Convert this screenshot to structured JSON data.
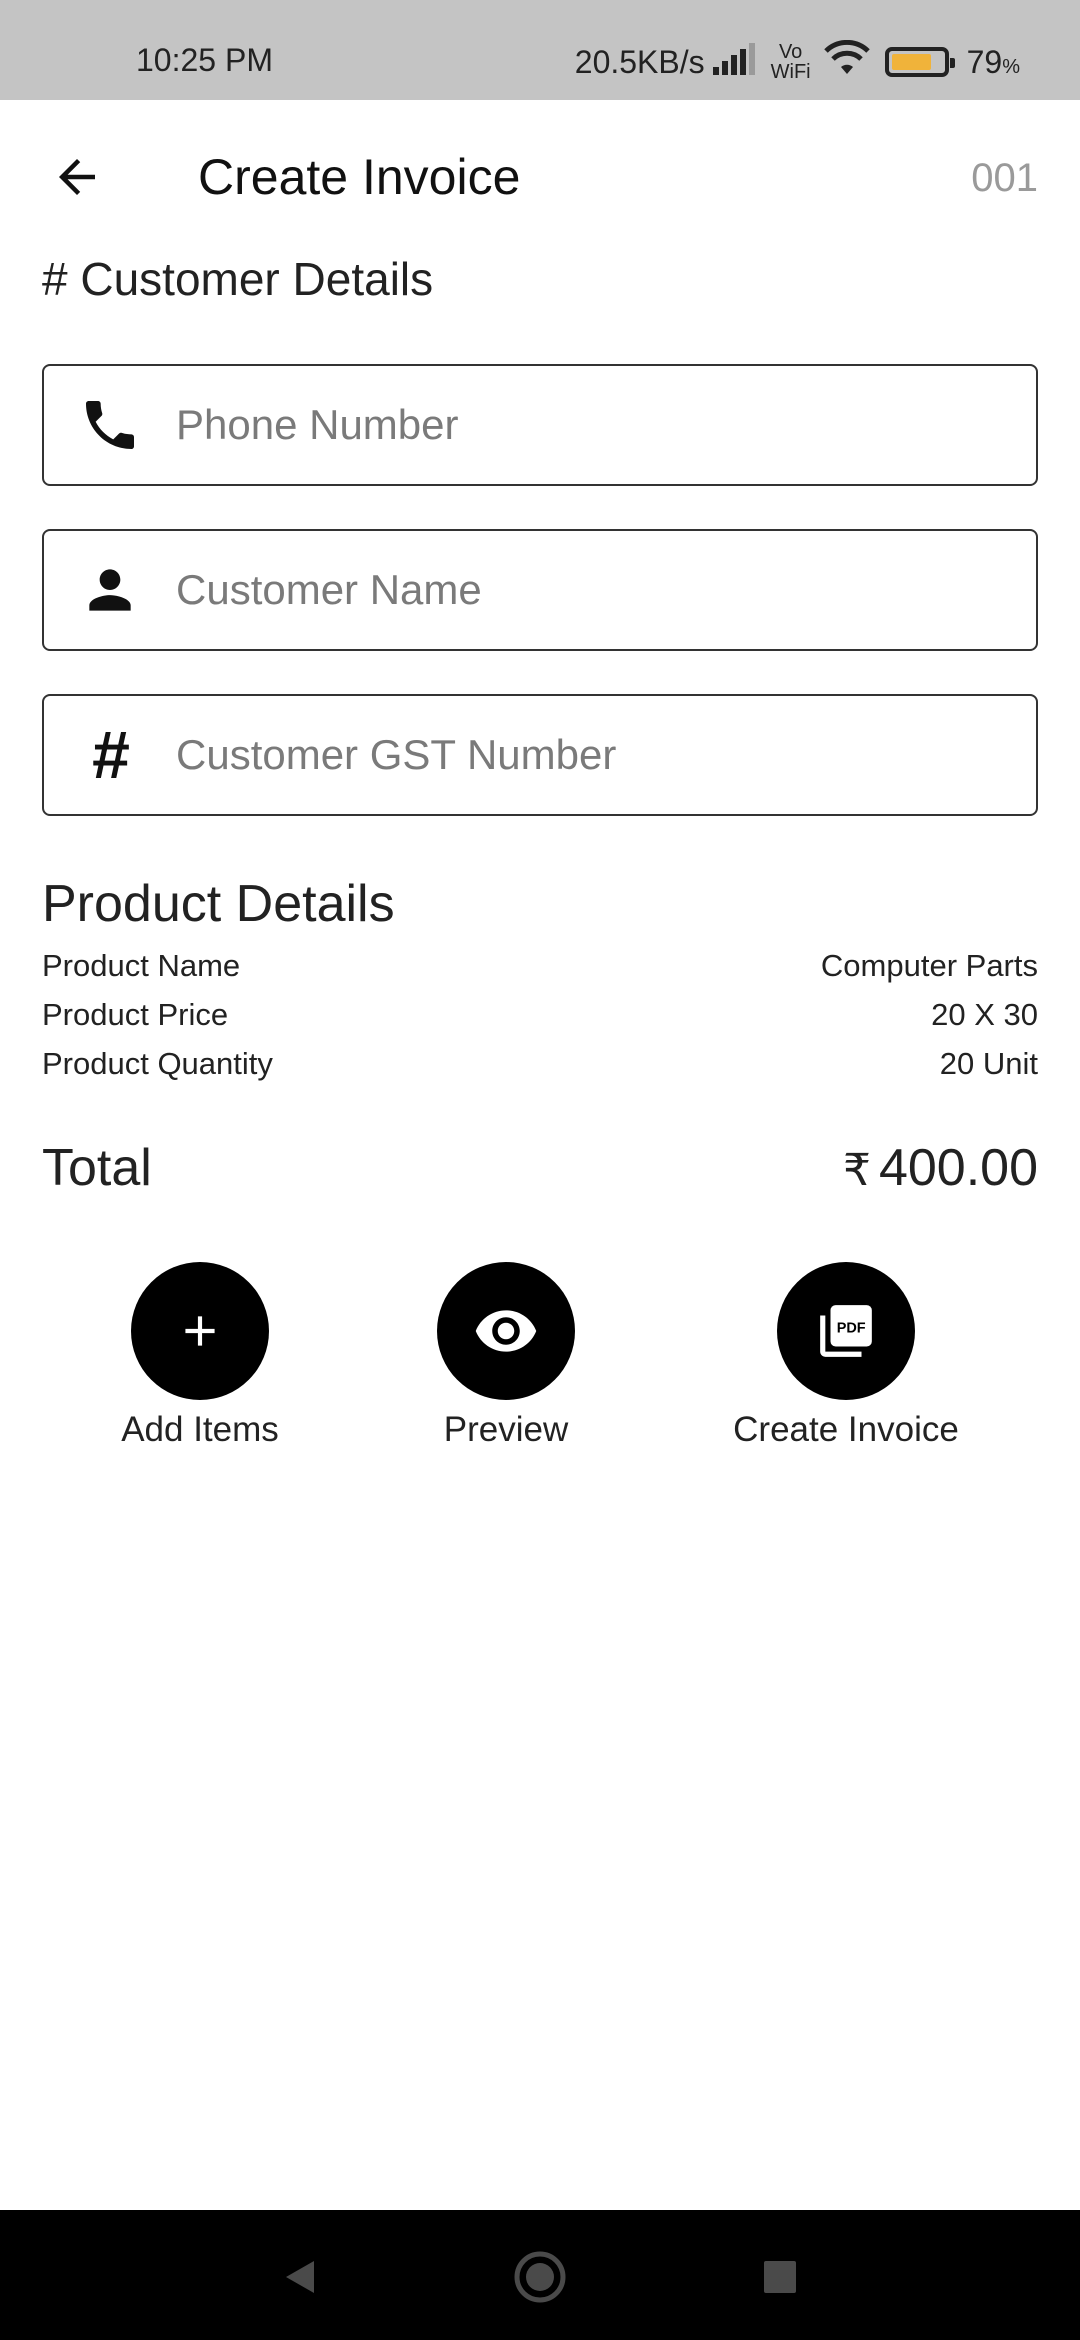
{
  "status_bar": {
    "time": "10:25 PM",
    "network_speed": "20.5KB/s",
    "vowifi_top": "Vo",
    "vowifi_bottom": "WiFi",
    "battery_percent": "79",
    "battery_percent_sign": "%",
    "battery_level": 0.79
  },
  "app_bar": {
    "title": "Create Invoice",
    "invoice_number": "001",
    "back_icon": "arrow-back-icon"
  },
  "customer_section": {
    "title": "# Customer Details",
    "fields": [
      {
        "icon": "phone-icon",
        "placeholder": "Phone Number",
        "value": ""
      },
      {
        "icon": "person-icon",
        "placeholder": "Customer Name",
        "value": ""
      },
      {
        "icon": "hash-icon",
        "glyph": "#",
        "placeholder": "Customer GST Number",
        "value": ""
      }
    ]
  },
  "product_section": {
    "title": "Product Details",
    "rows": [
      {
        "label": "Product Name",
        "value": "Computer Parts"
      },
      {
        "label": "Product Price",
        "value": "20 X 30"
      },
      {
        "label": "Product Quantity",
        "value": "20 Unit"
      }
    ]
  },
  "total": {
    "label": "Total",
    "currency": "₹",
    "amount": "400.00"
  },
  "actions": [
    {
      "label": "Add Items",
      "icon": "add-icon"
    },
    {
      "label": "Preview",
      "icon": "eye-icon"
    },
    {
      "label": "Create Invoice",
      "icon": "pdf-icon"
    }
  ],
  "nav_bar": {
    "icons": [
      "nav-back-icon",
      "nav-home-icon",
      "nav-recents-icon"
    ]
  },
  "colors": {
    "status_bar_bg": "#c4c4c4",
    "battery_fill": "#f0b33a",
    "accent": "#000000",
    "placeholder": "#7a7a7a",
    "invoice_number": "#9a9a9a"
  }
}
